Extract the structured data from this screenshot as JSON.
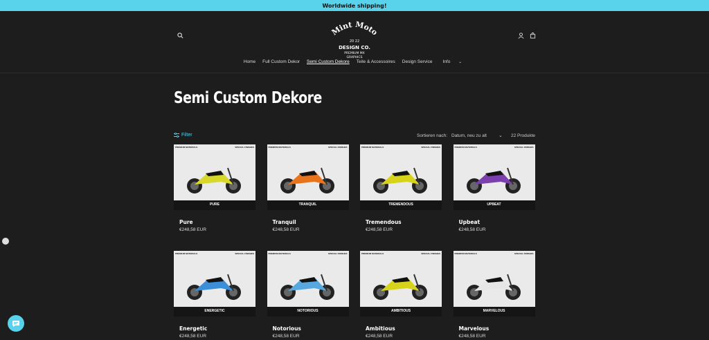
{
  "announcement": "Worldwide shipping!",
  "logo": {
    "line1": "Mint Moto",
    "year": "20 22",
    "line2": "DESIGN CO.",
    "line3": "PREMIUM MX",
    "line4": "GRAPHICS"
  },
  "nav": [
    {
      "label": "Home"
    },
    {
      "label": "Full Custom Dekor"
    },
    {
      "label": "Semi Custom Dekore",
      "active": true
    },
    {
      "label": "Teile & Accessoires"
    },
    {
      "label": "Design Service"
    },
    {
      "label": "Info"
    }
  ],
  "page_title": "Semi Custom Dekore",
  "filter": {
    "label": "Filter",
    "sort_label": "Sortieren nach:",
    "sort_value": "Datum, neu zu alt",
    "count": "22 Produkte"
  },
  "products": [
    {
      "name": "Pure",
      "price": "€248,58 EUR",
      "badge": "PURE",
      "accent": "#d8d82a"
    },
    {
      "name": "Tranquil",
      "price": "€248,58 EUR",
      "badge": "TRANQUIL",
      "accent": "#e8731d"
    },
    {
      "name": "Tremendous",
      "price": "€248,58 EUR",
      "badge": "TREMENDOUS",
      "accent": "#d6d31a"
    },
    {
      "name": "Upbeat",
      "price": "€248,58 EUR",
      "badge": "UPBEAT",
      "accent": "#7b3fae"
    },
    {
      "name": "Energetic",
      "price": "€248,58 EUR",
      "badge": "ENERGETIC",
      "accent": "#3a8fd8"
    },
    {
      "name": "Notorious",
      "price": "€248,58 EUR",
      "badge": "NOTORIOUS",
      "accent": "#58a8e0"
    },
    {
      "name": "Ambitious",
      "price": "€248,58 EUR",
      "badge": "AMBITIOUS",
      "accent": "#d6d31a"
    },
    {
      "name": "Marvelous",
      "price": "€248,58 EUR",
      "badge": "MARVELOUS",
      "accent": "#e6e6e6"
    }
  ],
  "card_text": {
    "left": "PREMIUM MATERIALS",
    "right": "SPECIAL FINISHES"
  }
}
